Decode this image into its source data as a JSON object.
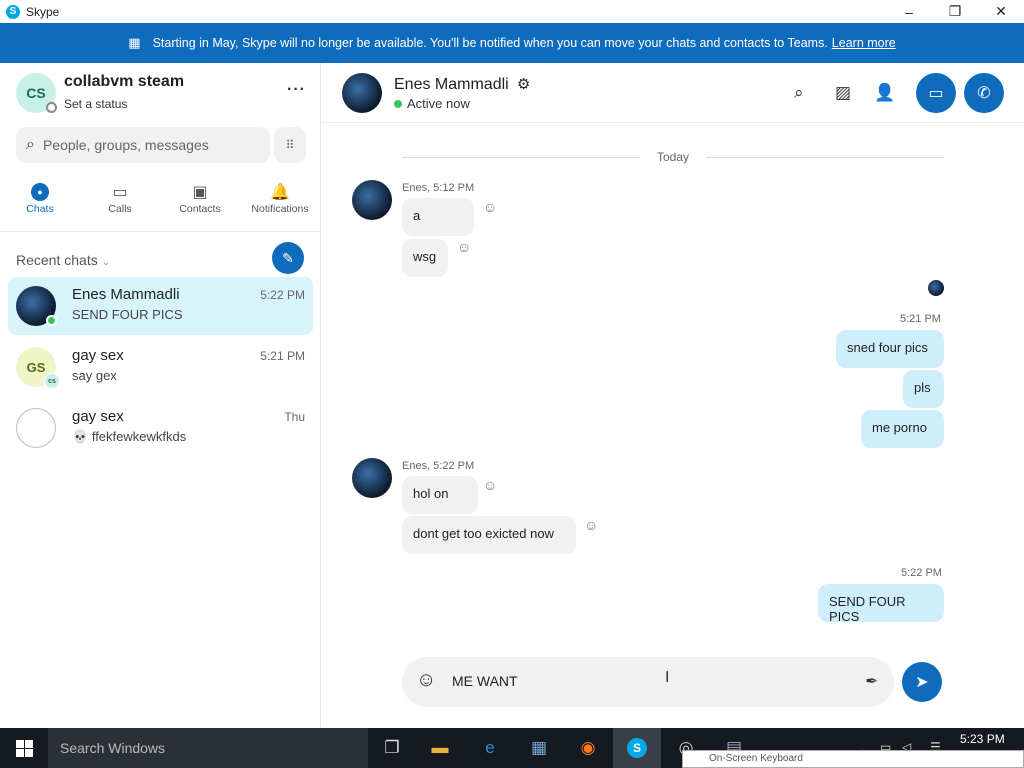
{
  "window": {
    "app_title": "Skype",
    "minimize": "–",
    "maximize": "❐",
    "close": "✕"
  },
  "banner": {
    "text": "Starting in May, Skype will no longer be available. You'll be notified when you can move your chats and contacts to Teams.",
    "link": "Learn more"
  },
  "profile": {
    "initials": "CS",
    "name": "collabvm steam",
    "status": "Set a status",
    "more": "···"
  },
  "search": {
    "placeholder": "People, groups, messages"
  },
  "nav": [
    {
      "label": "Chats",
      "icon": "chat-bubble-icon"
    },
    {
      "label": "Calls",
      "icon": "video-camera-icon"
    },
    {
      "label": "Contacts",
      "icon": "contact-card-icon"
    },
    {
      "label": "Notifications",
      "icon": "bell-icon"
    }
  ],
  "recent_chats_label": "Recent chats",
  "chats": [
    {
      "name": "Enes Mammadli",
      "preview": "SEND FOUR PICS",
      "time": "5:22 PM"
    },
    {
      "name": "gay sex",
      "preview": "say gex",
      "time": "5:21 PM",
      "initials": "GS",
      "mini_initials": "cs"
    },
    {
      "name": "gay sex",
      "preview": "ffekfewkewkfkds",
      "time": "Thu",
      "preview_icon": "💀"
    }
  ],
  "conversation": {
    "name": "Enes Mammadli",
    "status": "Active now",
    "date_divider": "Today",
    "groups": [
      {
        "meta": "Enes, 5:12 PM",
        "messages": [
          "a",
          "wsg"
        ]
      },
      {
        "meta": "5:21 PM",
        "messages": [
          "sned four pics",
          "pls",
          "me porno"
        ]
      },
      {
        "meta": "Enes, 5:22 PM",
        "messages": [
          "hol on",
          "dont get too exicted now"
        ]
      },
      {
        "meta": "5:22 PM",
        "messages": [
          "SEND FOUR PICS"
        ]
      }
    ],
    "composer_text": "ME WANT"
  },
  "taskbar": {
    "search_placeholder": "Search Windows",
    "clock": "5:23 PM",
    "osk_title": "On-Screen Keyboard"
  },
  "colors": {
    "accent": "#0f6cbd",
    "outgoing_bubble": "#cfeefc",
    "incoming_bubble": "#f1f1f1",
    "online": "#3cc35a"
  }
}
